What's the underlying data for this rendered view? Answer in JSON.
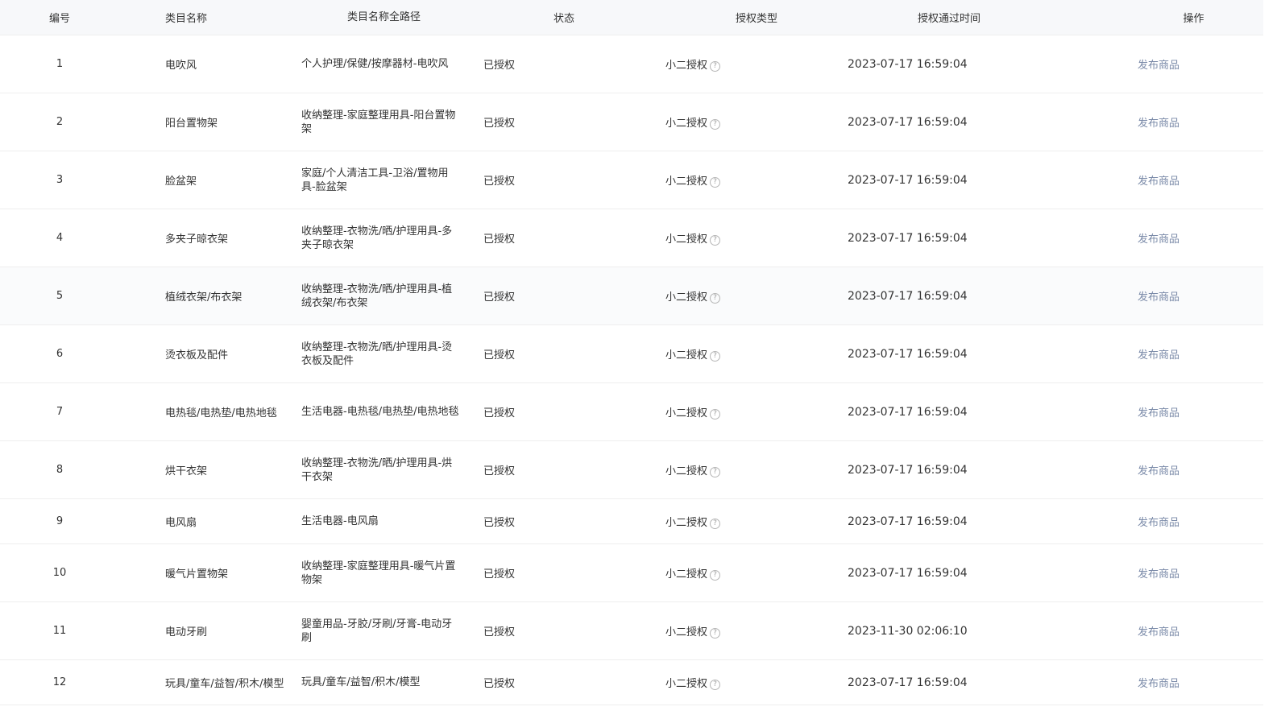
{
  "header": {
    "no": "编号",
    "name": "类目名称",
    "path": "类目名称全路径",
    "status": "状态",
    "auth_type": "授权类型",
    "auth_time": "授权通过时间",
    "op": "操作"
  },
  "help_glyph": "?",
  "rows": [
    {
      "no": "1",
      "name": "电吹风",
      "path": "个人护理/保健/按摩器材-电吹风",
      "status": "已授权",
      "auth_type": "小二授权",
      "time": "2023-07-17 16:59:04",
      "op": "发布商品"
    },
    {
      "no": "2",
      "name": "阳台置物架",
      "path": "收纳整理-家庭整理用具-阳台置物架",
      "status": "已授权",
      "auth_type": "小二授权",
      "time": "2023-07-17 16:59:04",
      "op": "发布商品"
    },
    {
      "no": "3",
      "name": "脸盆架",
      "path": "家庭/个人清洁工具-卫浴/置物用具-脸盆架",
      "status": "已授权",
      "auth_type": "小二授权",
      "time": "2023-07-17 16:59:04",
      "op": "发布商品"
    },
    {
      "no": "4",
      "name": "多夹子晾衣架",
      "path": "收纳整理-衣物洗/晒/护理用具-多夹子晾衣架",
      "status": "已授权",
      "auth_type": "小二授权",
      "time": "2023-07-17 16:59:04",
      "op": "发布商品"
    },
    {
      "no": "5",
      "name": "植绒衣架/布衣架",
      "path": "收纳整理-衣物洗/晒/护理用具-植绒衣架/布衣架",
      "status": "已授权",
      "auth_type": "小二授权",
      "time": "2023-07-17 16:59:04",
      "op": "发布商品"
    },
    {
      "no": "6",
      "name": "烫衣板及配件",
      "path": "收纳整理-衣物洗/晒/护理用具-烫衣板及配件",
      "status": "已授权",
      "auth_type": "小二授权",
      "time": "2023-07-17 16:59:04",
      "op": "发布商品"
    },
    {
      "no": "7",
      "name": "电热毯/电热垫/电热地毯",
      "path": "生活电器-电热毯/电热垫/电热地毯",
      "status": "已授权",
      "auth_type": "小二授权",
      "time": "2023-07-17 16:59:04",
      "op": "发布商品"
    },
    {
      "no": "8",
      "name": "烘干衣架",
      "path": "收纳整理-衣物洗/晒/护理用具-烘干衣架",
      "status": "已授权",
      "auth_type": "小二授权",
      "time": "2023-07-17 16:59:04",
      "op": "发布商品"
    },
    {
      "no": "9",
      "name": "电风扇",
      "path": "生活电器-电风扇",
      "status": "已授权",
      "auth_type": "小二授权",
      "time": "2023-07-17 16:59:04",
      "op": "发布商品"
    },
    {
      "no": "10",
      "name": "暖气片置物架",
      "path": "收纳整理-家庭整理用具-暖气片置物架",
      "status": "已授权",
      "auth_type": "小二授权",
      "time": "2023-07-17 16:59:04",
      "op": "发布商品"
    },
    {
      "no": "11",
      "name": "电动牙刷",
      "path": "婴童用品-牙胶/牙刷/牙膏-电动牙刷",
      "status": "已授权",
      "auth_type": "小二授权",
      "time": "2023-11-30 02:06:10",
      "op": "发布商品"
    },
    {
      "no": "12",
      "name": "玩具/童车/益智/积木/模型",
      "path": "玩具/童车/益智/积木/模型",
      "status": "已授权",
      "auth_type": "小二授权",
      "time": "2023-07-17 16:59:04",
      "op": "发布商品"
    }
  ]
}
